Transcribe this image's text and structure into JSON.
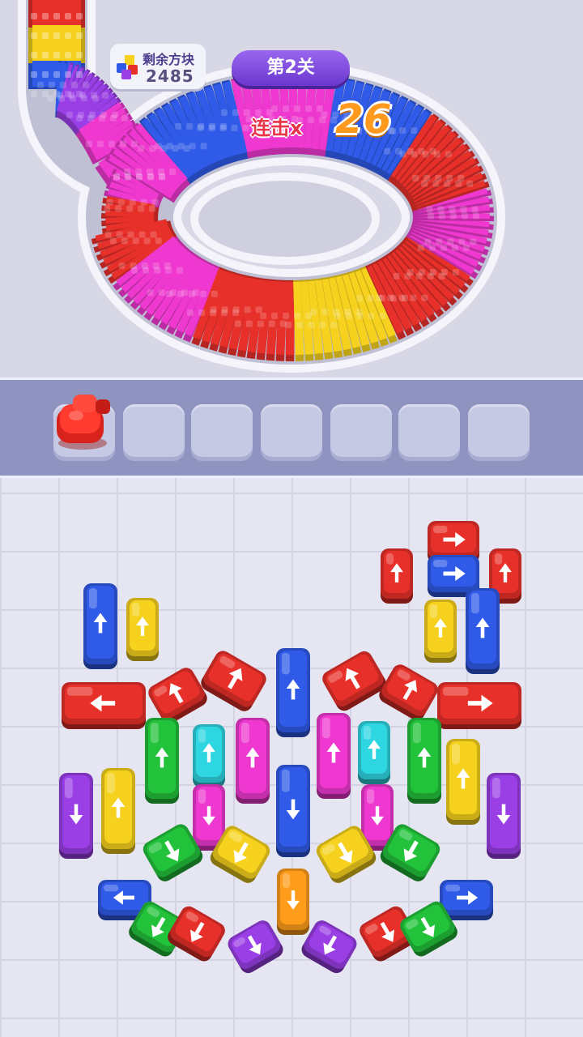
{
  "hud": {
    "remaining_label": "剩余方块",
    "remaining_value": "2485",
    "level_label": "第2关",
    "combo_label": "连击x",
    "combo_value": "26"
  },
  "colors": {
    "red": "#e8302a",
    "yellow": "#f6d21f",
    "blue": "#2f5be8",
    "magenta": "#ee38cf",
    "purple": "#9a3ee6",
    "green": "#22c23a",
    "cyan": "#2ed6e2",
    "orange": "#ff9d1a"
  },
  "track_segments": [
    "red",
    "yellow",
    "blue",
    "purple",
    "magenta",
    "red",
    "magenta",
    "red",
    "yellow",
    "red",
    "magenta",
    "red",
    "blue",
    "magenta",
    "blue",
    "magenta",
    "purple"
  ],
  "slots": {
    "total": 7,
    "filled": [
      {
        "color": "red",
        "icon": "car-icon"
      }
    ]
  },
  "cars": [
    {
      "c": "red",
      "d": "right"
    },
    {
      "c": "red",
      "d": "up"
    },
    {
      "c": "blue",
      "d": "right"
    },
    {
      "c": "red",
      "d": "up"
    },
    {
      "c": "yellow",
      "d": "up"
    },
    {
      "c": "blue",
      "d": "up"
    },
    {
      "c": "blue",
      "d": "up"
    },
    {
      "c": "yellow",
      "d": "up"
    },
    {
      "c": "red",
      "d": "left"
    },
    {
      "c": "red",
      "d": "up-left"
    },
    {
      "c": "red",
      "d": "up-right"
    },
    {
      "c": "blue",
      "d": "up"
    },
    {
      "c": "red",
      "d": "up-left"
    },
    {
      "c": "red",
      "d": "up-right"
    },
    {
      "c": "red",
      "d": "right"
    },
    {
      "c": "green",
      "d": "up"
    },
    {
      "c": "cyan",
      "d": "up"
    },
    {
      "c": "magenta",
      "d": "up"
    },
    {
      "c": "magenta",
      "d": "up"
    },
    {
      "c": "cyan",
      "d": "up"
    },
    {
      "c": "green",
      "d": "up"
    },
    {
      "c": "yellow",
      "d": "up"
    },
    {
      "c": "purple",
      "d": "down"
    },
    {
      "c": "yellow",
      "d": "up"
    },
    {
      "c": "magenta",
      "d": "down"
    },
    {
      "c": "blue",
      "d": "down"
    },
    {
      "c": "magenta",
      "d": "down"
    },
    {
      "c": "purple",
      "d": "down"
    },
    {
      "c": "green",
      "d": "down-right"
    },
    {
      "c": "yellow",
      "d": "down-left"
    },
    {
      "c": "yellow",
      "d": "down-right"
    },
    {
      "c": "green",
      "d": "down-left"
    },
    {
      "c": "blue",
      "d": "left"
    },
    {
      "c": "orange",
      "d": "down"
    },
    {
      "c": "blue",
      "d": "right"
    },
    {
      "c": "green",
      "d": "down-left"
    },
    {
      "c": "red",
      "d": "down-left"
    },
    {
      "c": "purple",
      "d": "down-right"
    },
    {
      "c": "purple",
      "d": "down-left"
    },
    {
      "c": "red",
      "d": "down-right"
    },
    {
      "c": "green",
      "d": "down-right"
    }
  ]
}
